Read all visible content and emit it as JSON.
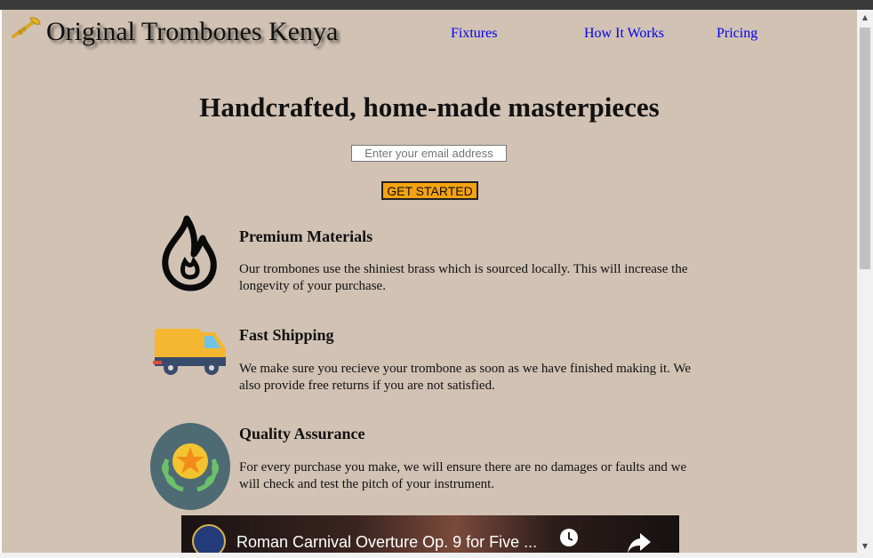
{
  "header": {
    "brand": "Original Trombones Kenya",
    "nav": [
      "Fixtures",
      "How It Works",
      "Pricing"
    ]
  },
  "hero": {
    "title": "Handcrafted, home-made masterpieces",
    "email_placeholder": "Enter your email address",
    "cta_label": "GET STARTED"
  },
  "features": [
    {
      "icon": "fire-icon",
      "title": "Premium Materials",
      "text": "Our trombones use the shiniest brass which is sourced locally. This will increase the longevity of your purchase."
    },
    {
      "icon": "truck-icon",
      "title": "Fast Shipping",
      "text": "We make sure you recieve your trombone as soon as we have finished making it. We also provide free returns if you are not satisfied."
    },
    {
      "icon": "award-badge-icon",
      "title": "Quality Assurance",
      "text": "For every purchase you make, we will ensure there are no damages or faults and we will check and test the pitch of your instrument."
    }
  ],
  "video": {
    "title": "Roman Carnival Overture Op. 9 for Five ..."
  },
  "colors": {
    "page_background": "#d1c2b4",
    "cta_background": "#f5a30f",
    "link": "#0000ee"
  }
}
